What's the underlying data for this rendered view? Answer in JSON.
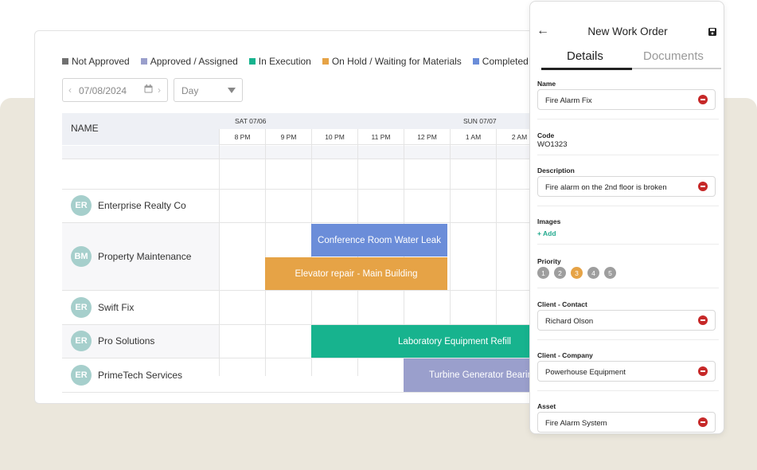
{
  "legend": [
    {
      "label": "Not Approved",
      "color": "#707070"
    },
    {
      "label": "Approved / Assigned",
      "color": "#9a9fcc"
    },
    {
      "label": "In Execution",
      "color": "#17b38e"
    },
    {
      "label": "On Hold / Waiting for Materials",
      "color": "#e6a346"
    },
    {
      "label": "Completed",
      "color": "#6b8dd9"
    }
  ],
  "toolbar": {
    "date": "07/08/2024",
    "view": "Day"
  },
  "grid": {
    "name_header": "NAME",
    "days": [
      "SAT 07/06",
      "SUN 07/07"
    ],
    "hours": [
      "8 PM",
      "9 PM",
      "10 PM",
      "11 PM",
      "12 PM",
      "1 AM",
      "2 AM"
    ]
  },
  "resources": [
    {
      "initials": "ER",
      "name": "Enterprise Realty Co"
    },
    {
      "initials": "BM",
      "name": "Property Maintenance"
    },
    {
      "initials": "ER",
      "name": "Swift Fix"
    },
    {
      "initials": "ER",
      "name": "Pro Solutions"
    },
    {
      "initials": "ER",
      "name": "PrimeTech Services"
    }
  ],
  "events": [
    {
      "label": "Conference Room Water Leak",
      "color": "#6b8dd9"
    },
    {
      "label": "Elevator repair - Main Building",
      "color": "#e6a346"
    },
    {
      "label": "Laboratory Equipment Refill",
      "color": "#17b38e"
    },
    {
      "label": "Turbine Generator Bearing",
      "color": "#9a9fcc"
    }
  ],
  "panel": {
    "title": "New Work Order",
    "tabs": {
      "details": "Details",
      "documents": "Documents"
    },
    "name_label": "Name",
    "name_value": "Fire Alarm Fix",
    "code_label": "Code",
    "code_value": "WO1323",
    "description_label": "Description",
    "description_value": "Fire alarm on the 2nd floor is broken",
    "images_label": "Images",
    "add_label": "+ Add",
    "priority_label": "Priority",
    "priorities": [
      "1",
      "2",
      "3",
      "4",
      "5"
    ],
    "selected_priority": "3",
    "contact_label": "Client - Contact",
    "contact_value": "Richard Olson",
    "company_label": "Client - Company",
    "company_value": "Powerhouse Equipment",
    "asset_label": "Asset",
    "asset_value": "Fire Alarm System"
  },
  "colors": {
    "accent": "#22a98e",
    "selected_priority": "#e6a346",
    "priority_default": "#9e9e9e",
    "remove": "#c62828"
  }
}
